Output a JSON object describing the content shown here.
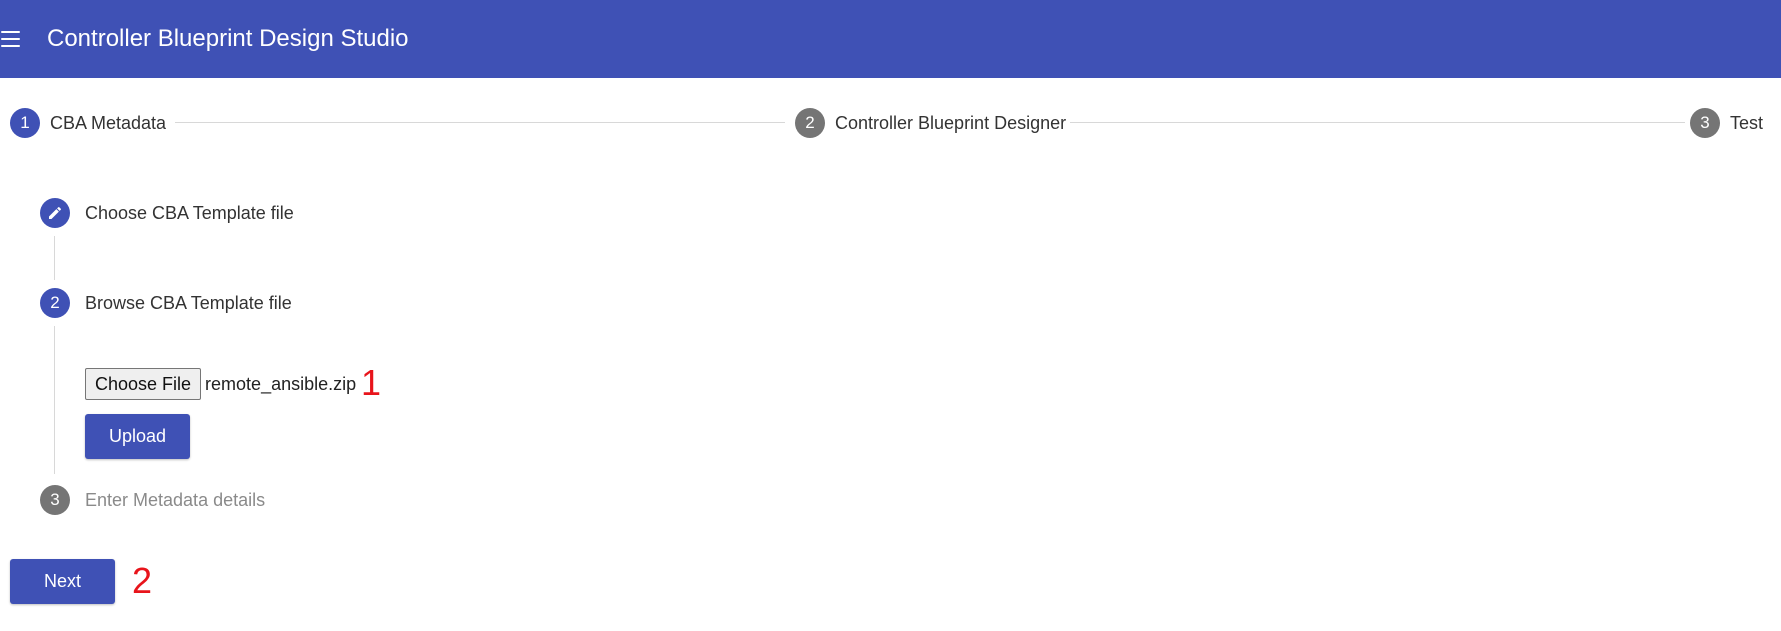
{
  "app": {
    "title": "Controller Blueprint Design Studio",
    "menu_icon": "hamburger-menu-icon",
    "brand_color": "#3f51b5"
  },
  "stepper": {
    "steps": [
      {
        "number": "1",
        "label": "CBA Metadata",
        "state": "active"
      },
      {
        "number": "2",
        "label": "Controller Blueprint Designer",
        "state": "inactive"
      },
      {
        "number": "3",
        "label": "Test",
        "state": "inactive"
      }
    ]
  },
  "vertical_steps": [
    {
      "icon": "pencil-icon",
      "label": "Choose CBA Template file",
      "state": "edit"
    },
    {
      "number": "2",
      "label": "Browse CBA Template file",
      "state": "active"
    },
    {
      "number": "3",
      "label": "Enter Metadata details",
      "state": "inactive"
    }
  ],
  "file_input": {
    "button_label": "Choose File",
    "selected_file": "remote_ansible.zip"
  },
  "upload_button": {
    "label": "Upload"
  },
  "next_button": {
    "label": "Next"
  },
  "annotations": {
    "first": "1",
    "second": "2",
    "color": "#e8141b"
  }
}
